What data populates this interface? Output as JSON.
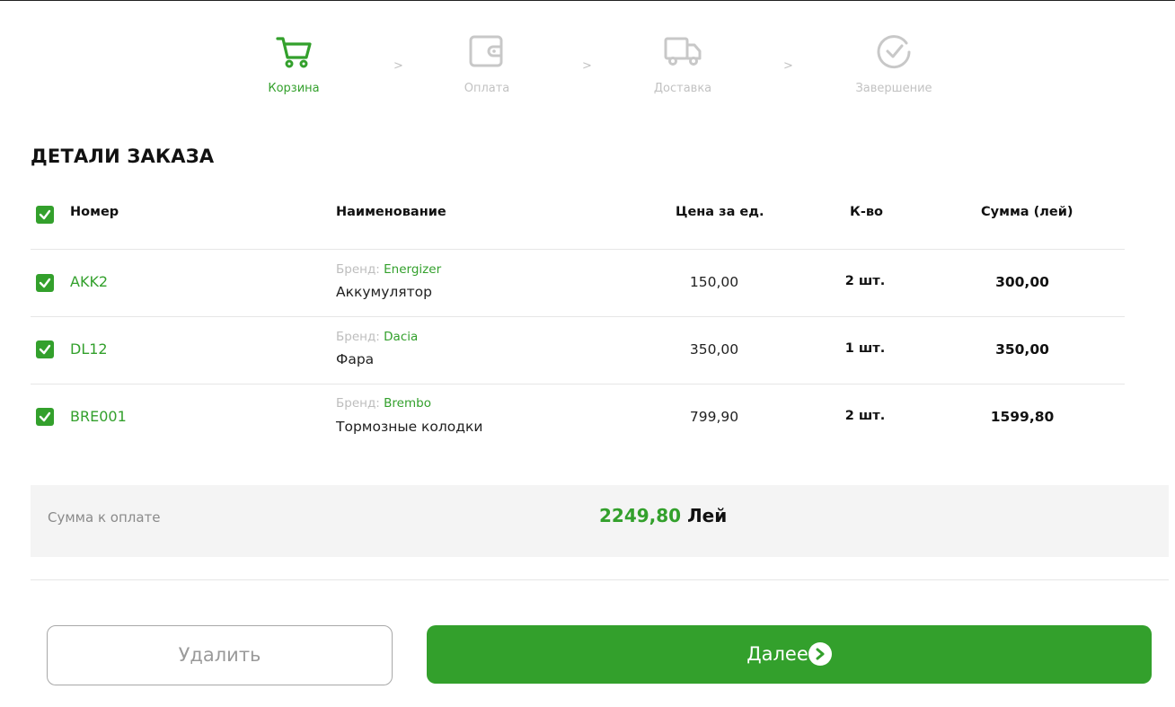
{
  "steps": [
    {
      "label": "Корзина",
      "icon": "cart-icon",
      "active": true
    },
    {
      "label": "Оплата",
      "icon": "wallet-icon",
      "active": false
    },
    {
      "label": "Доставка",
      "icon": "truck-icon",
      "active": false
    },
    {
      "label": "Завершение",
      "icon": "check-circle-icon",
      "active": false
    }
  ],
  "step_separator": ">",
  "page_title": "ДЕТАЛИ ЗАКАЗА",
  "table": {
    "headers": {
      "code": "Номер",
      "name": "Наименование",
      "price": "Цена за ед.",
      "qty": "К-во",
      "sum": "Сумма (лей)"
    },
    "brand_prefix": "Бренд:",
    "rows": [
      {
        "code": "AKK2",
        "brand": "Energizer",
        "name": "Аккумулятор",
        "price": "150,00",
        "qty": "2 шт.",
        "sum": "300,00",
        "checked": true
      },
      {
        "code": "DL12",
        "brand": "Dacia",
        "name": "Фара",
        "price": "350,00",
        "qty": "1 шт.",
        "sum": "350,00",
        "checked": true
      },
      {
        "code": "BRE001",
        "brand": "Brembo",
        "name": "Тормозные колодки",
        "price": "799,90",
        "qty": "2 шт.",
        "sum": "1599,80",
        "checked": true
      }
    ]
  },
  "total": {
    "label": "Сумма к оплате",
    "amount": "2249,80",
    "currency": "Лей"
  },
  "buttons": {
    "delete": "Удалить",
    "next": "Далее"
  },
  "colors": {
    "accent": "#33a02c",
    "muted": "#c2c2c2",
    "panel": "#f4f4f4"
  }
}
